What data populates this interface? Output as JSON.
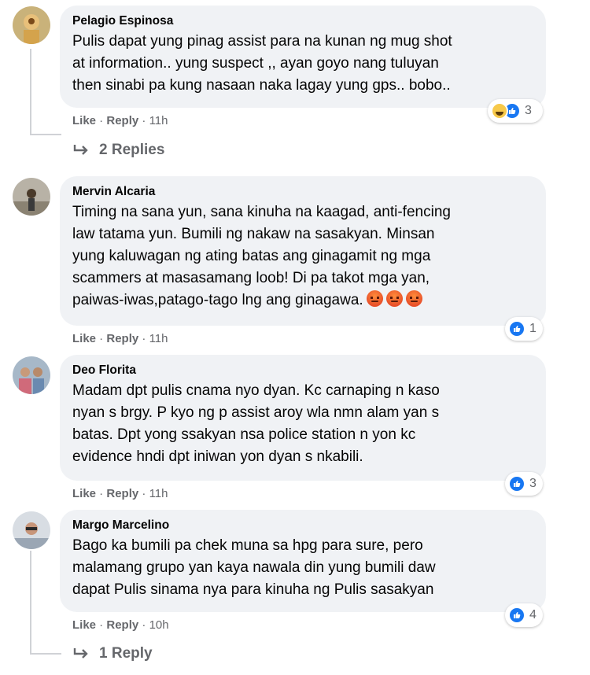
{
  "colors": {
    "bubble": "#f0f2f5",
    "meta_text": "#65676b",
    "like_blue": "#1877f2",
    "angry": "#e8502a"
  },
  "comments": [
    {
      "author": "Pelagio Espinosa",
      "text": "Pulis dapat yung pinag assist para na kunan ng mug shot\nat information.. yung suspect ,, ayan goyo nang tuluyan\nthen sinabi pa kung nasaan naka lagay yung gps.. bobo..",
      "like": "Like",
      "reply": "Reply",
      "time": "11h",
      "reaction_icons": [
        "haha-icon",
        "like-icon"
      ],
      "reaction_count": "3",
      "replies_label": "2 Replies"
    },
    {
      "author": "Mervin Alcaria",
      "text": "Timing na sana yun, sana kinuha na kaagad, anti-fencing\nlaw tatama yun. Bumili ng nakaw na sasakyan. Minsan\nyung kaluwagan ng ating batas ang ginagamit ng mga\nscammers at masasamang loob! Di pa takot mga yan,\npaiwas-iwas,patago-tago lng ang ginagawa.",
      "trailing_emojis": [
        "angry-icon",
        "angry-icon",
        "angry-icon"
      ],
      "like": "Like",
      "reply": "Reply",
      "time": "11h",
      "reaction_icons": [
        "like-icon"
      ],
      "reaction_count": "1"
    },
    {
      "author": "Deo Florita",
      "text": "Madam dpt pulis cnama nyo dyan. Kc carnaping n kaso\nnyan s brgy. P kyo ng p assist aroy wla nmn alam yan s\nbatas. Dpt yong ssakyan nsa police station n yon kc\nevidence hndi dpt iniwan yon dyan s nkabili.",
      "like": "Like",
      "reply": "Reply",
      "time": "11h",
      "reaction_icons": [
        "like-icon"
      ],
      "reaction_count": "3"
    },
    {
      "author": "Margo Marcelino",
      "text": "Bago ka bumili pa chek muna sa hpg para sure, pero\nmalamang grupo yan kaya nawala din yung bumili daw\ndapat Pulis sinama nya para kinuha ng Pulis sasakyan",
      "like": "Like",
      "reply": "Reply",
      "time": "10h",
      "reaction_icons": [
        "like-icon"
      ],
      "reaction_count": "4",
      "replies_label": "1 Reply"
    }
  ]
}
